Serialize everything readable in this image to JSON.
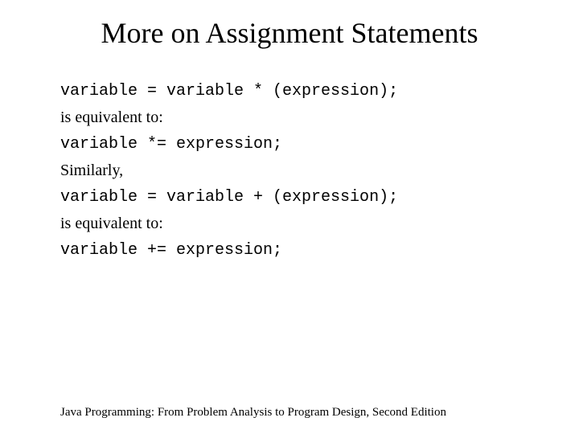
{
  "title": "More on Assignment Statements",
  "lines": {
    "l1": "variable = variable * (expression);",
    "l2": "is equivalent to:",
    "l3": "variable *= expression;",
    "l4": "Similarly,",
    "l5": "variable = variable + (expression);",
    "l6": "is equivalent to:",
    "l7": "variable += expression;"
  },
  "footer": "Java Programming: From Problem Analysis to Program Design, Second Edition"
}
